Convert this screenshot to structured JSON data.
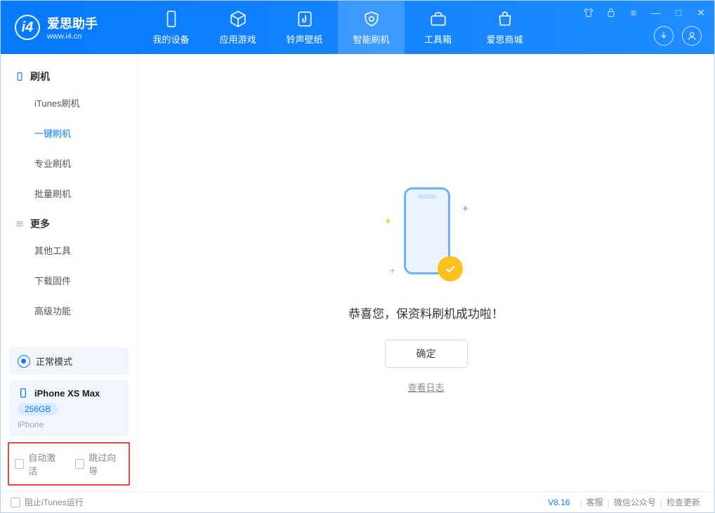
{
  "app": {
    "title": "爱思助手",
    "subtitle": "www.i4.cn"
  },
  "nav": {
    "device": "我的设备",
    "apps": "应用游戏",
    "ringtone": "铃声壁纸",
    "flash": "智能刷机",
    "toolbox": "工具箱",
    "store": "爱思商城"
  },
  "sidebar": {
    "group_flash": "刷机",
    "items_flash": {
      "itunes": "iTunes刷机",
      "oneclick": "一键刷机",
      "pro": "专业刷机",
      "batch": "批量刷机"
    },
    "group_more": "更多",
    "items_more": {
      "other": "其他工具",
      "firmware": "下载固件",
      "advanced": "高级功能"
    },
    "mode": "正常模式",
    "device": {
      "name": "iPhone XS Max",
      "capacity": "256GB",
      "type": "iPhone"
    },
    "options": {
      "auto_activate": "自动激活",
      "skip_guide": "跳过向导"
    }
  },
  "main": {
    "success": "恭喜您，保资料刷机成功啦！",
    "ok": "确定",
    "view_log": "查看日志"
  },
  "status": {
    "block_itunes": "阻止iTunes运行",
    "version": "V8.16",
    "support": "客服",
    "wechat": "微信公众号",
    "update": "检查更新"
  }
}
